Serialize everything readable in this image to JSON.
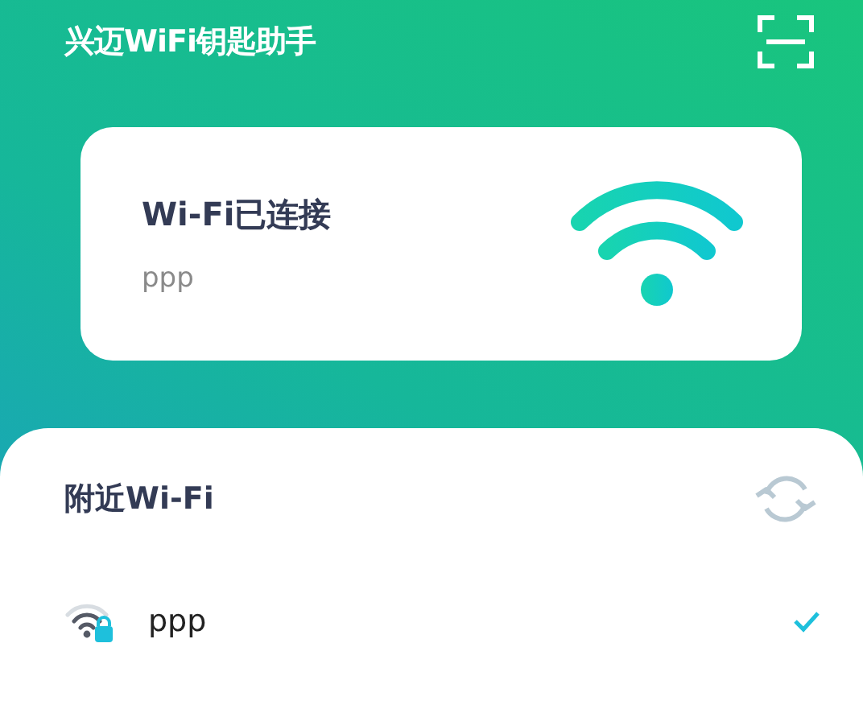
{
  "header": {
    "title": "兴迈WiFi钥匙助手"
  },
  "status_card": {
    "title": "Wi-Fi已连接",
    "ssid": "ppp"
  },
  "nearby": {
    "title": "附近Wi-Fi",
    "networks": [
      {
        "name": "ppp",
        "secured": true,
        "connected": true
      }
    ]
  }
}
